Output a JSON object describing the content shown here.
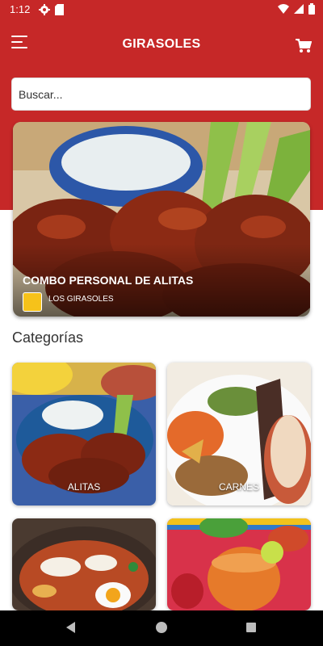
{
  "status_bar": {
    "time": "1:12",
    "icons": [
      "settings-icon",
      "sd-card-icon",
      "wifi-icon",
      "signal-icon",
      "battery-icon"
    ]
  },
  "app_bar": {
    "title": "GIRASOLES",
    "menu_icon": "menu-icon",
    "cart_icon": "cart-icon",
    "color": "#c62828"
  },
  "search": {
    "placeholder": "Buscar..."
  },
  "featured": {
    "title": "COMBO PERSONAL DE ALITAS",
    "store": "LOS GIRASOLES"
  },
  "categories": {
    "heading": "Categorías",
    "items": [
      {
        "label": "ALITAS"
      },
      {
        "label": "CARNES"
      },
      {
        "label": ""
      },
      {
        "label": ""
      }
    ]
  },
  "nav_bar": {
    "icons": [
      "back-icon",
      "home-icon",
      "recents-icon"
    ]
  }
}
